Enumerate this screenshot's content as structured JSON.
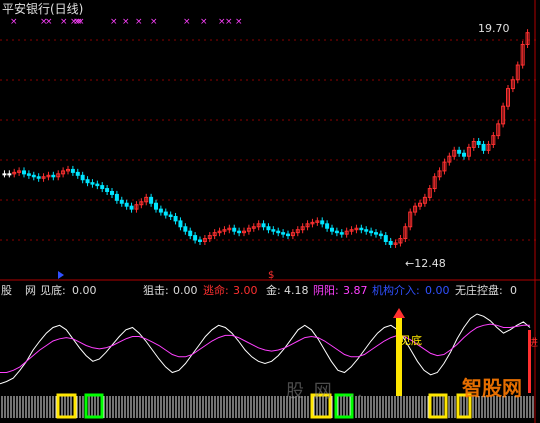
{
  "title": "平安银行(日线)",
  "price_high_label": "19.70",
  "price_low_label": "←12.48",
  "indicator_labels": {
    "gu": "股",
    "net": "网",
    "jiandi": "见底:",
    "jiandi_val": "0.00",
    "juji": "狙击:",
    "juji_val": "0.00",
    "taoming": "逃命:",
    "taoming_val": "3.00",
    "jin": "金:",
    "jin_val": "4.18",
    "yinyang": "阴阳:",
    "yinyang_val": "3.87",
    "jigou": "机构介入:",
    "jigou_val": "0.00",
    "wuzhuang": "无庄控盘:",
    "wuzhuang_val": "0"
  },
  "jiandi_marker": "见底",
  "jiandi_right": "进",
  "watermark": "股 网 ...",
  "logo_text": "智股网",
  "colors": {
    "background": "#000000",
    "up": "#ff3030",
    "down": "#00e5ff",
    "flat": "#ffffff",
    "cross_marker": "#ff40ff",
    "grid": "#8b0000",
    "line_white": "#ffffff",
    "line_magenta": "#ff40ff",
    "yellow": "#ffe600",
    "green": "#00ff00",
    "purple": "#ff40ff",
    "blue": "#3050ff",
    "red": "#ff3030"
  },
  "chart_data": {
    "type": "candlestick",
    "y_range_price": [
      11.8,
      20.2
    ],
    "closes": [
      14.9,
      14.9,
      14.95,
      15.0,
      14.9,
      14.85,
      14.8,
      14.75,
      14.8,
      14.85,
      14.8,
      14.9,
      15.0,
      15.05,
      14.95,
      14.85,
      14.7,
      14.6,
      14.55,
      14.5,
      14.4,
      14.3,
      14.2,
      14.0,
      13.9,
      13.8,
      13.7,
      13.85,
      13.95,
      14.1,
      13.9,
      13.7,
      13.6,
      13.5,
      13.45,
      13.3,
      13.1,
      12.95,
      12.8,
      12.65,
      12.6,
      12.7,
      12.8,
      12.9,
      12.95,
      13.0,
      13.05,
      12.95,
      12.9,
      12.95,
      13.05,
      13.1,
      13.2,
      13.1,
      13.0,
      12.95,
      12.9,
      12.85,
      12.8,
      12.9,
      13.0,
      13.1,
      13.2,
      13.25,
      13.3,
      13.2,
      13.05,
      12.95,
      12.9,
      12.85,
      12.95,
      13.0,
      13.05,
      13.0,
      12.95,
      12.9,
      12.85,
      12.8,
      12.6,
      12.5,
      12.55,
      12.7,
      13.1,
      13.6,
      13.8,
      13.9,
      14.1,
      14.4,
      14.8,
      15.0,
      15.3,
      15.5,
      15.7,
      15.6,
      15.5,
      15.8,
      16.0,
      15.9,
      15.7,
      15.9,
      16.2,
      16.6,
      17.2,
      17.8,
      18.1,
      18.6,
      19.3,
      19.7
    ],
    "highs_note": "",
    "cross_marks": [
      10,
      40,
      45,
      60,
      70,
      73,
      75,
      77,
      110,
      122,
      135,
      150,
      183,
      200,
      218,
      225,
      235
    ],
    "osc_white": [
      10,
      12,
      15,
      22,
      30,
      40,
      48,
      55,
      60,
      62,
      58,
      50,
      42,
      35,
      30,
      32,
      38,
      45,
      52,
      58,
      60,
      55,
      48,
      40,
      32,
      25,
      20,
      22,
      28,
      36,
      44,
      52,
      58,
      62,
      60,
      55,
      48,
      40,
      34,
      30,
      28,
      30,
      35,
      42,
      50,
      58,
      62,
      58,
      50,
      40,
      30,
      22,
      20,
      25,
      32,
      40,
      48,
      55,
      60,
      62,
      58,
      50,
      40,
      30,
      22,
      18,
      20,
      28,
      38,
      50,
      60,
      68,
      72,
      70,
      66,
      60,
      55,
      58,
      62,
      65,
      60
    ],
    "osc_magenta": [
      20,
      20,
      22,
      25,
      30,
      35,
      40,
      44,
      48,
      50,
      51,
      50,
      47,
      44,
      42,
      41,
      42,
      44,
      47,
      50,
      52,
      52,
      50,
      47,
      44,
      40,
      36,
      34,
      34,
      36,
      40,
      44,
      48,
      51,
      53,
      53,
      51,
      48,
      45,
      42,
      40,
      39,
      40,
      42,
      45,
      48,
      51,
      52,
      51,
      48,
      44,
      40,
      36,
      34,
      34,
      36,
      40,
      44,
      48,
      51,
      53,
      52,
      49,
      45,
      41,
      37,
      35,
      36,
      40,
      45,
      51,
      56,
      60,
      62,
      63,
      62,
      60,
      60,
      61,
      62,
      62
    ]
  }
}
